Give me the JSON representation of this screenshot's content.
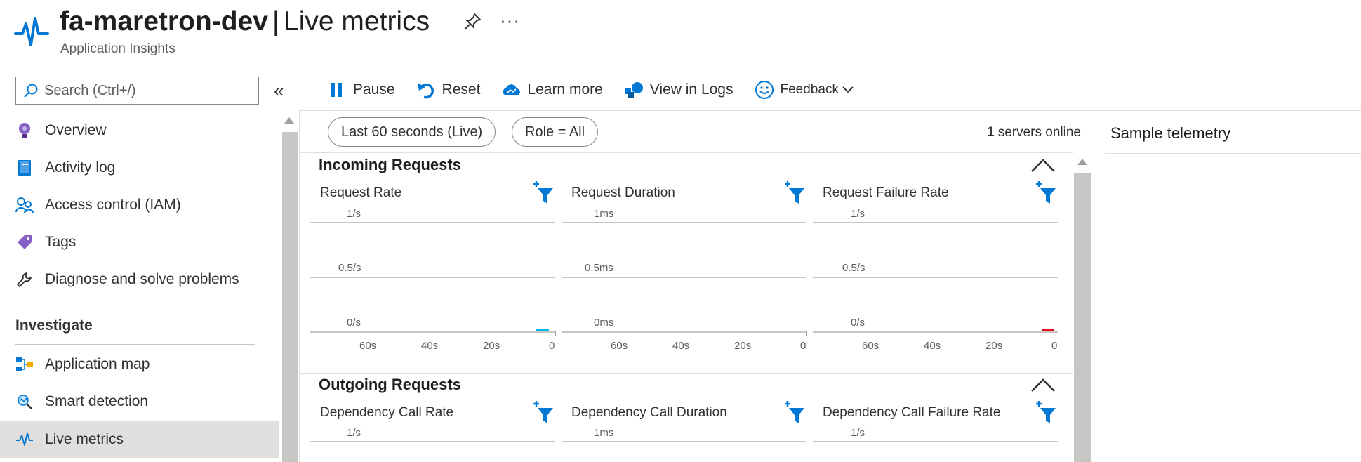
{
  "header": {
    "resource_name": "fa-maretron-dev",
    "separator": "|",
    "page_name": "Live metrics",
    "subtitle": "Application Insights",
    "more_label": "···"
  },
  "search": {
    "placeholder": "Search (Ctrl+/)",
    "collapse_label": "«"
  },
  "sidebar": {
    "items": [
      {
        "label": "Overview",
        "icon": "lightbulb-icon"
      },
      {
        "label": "Activity log",
        "icon": "book-icon"
      },
      {
        "label": "Access control (IAM)",
        "icon": "people-icon"
      },
      {
        "label": "Tags",
        "icon": "tag-icon"
      },
      {
        "label": "Diagnose and solve problems",
        "icon": "wrench-icon"
      }
    ],
    "section": "Investigate",
    "investigate_items": [
      {
        "label": "Application map",
        "icon": "app-map-icon"
      },
      {
        "label": "Smart detection",
        "icon": "smart-detection-icon"
      },
      {
        "label": "Live metrics",
        "icon": "pulse-icon",
        "active": true
      }
    ]
  },
  "toolbar": {
    "pause": "Pause",
    "reset": "Reset",
    "learn_more": "Learn more",
    "view_in_logs": "View in Logs",
    "feedback": "Feedback"
  },
  "filters": {
    "time_range": "Last 60 seconds (Live)",
    "role": "Role = All",
    "servers_count": "1",
    "servers_label": " servers online"
  },
  "sample_telemetry": {
    "title": "Sample telemetry"
  },
  "sections": {
    "incoming": {
      "title": "Incoming Requests",
      "charts": [
        {
          "title": "Request Rate",
          "y_top": "1/s",
          "y_mid": "0.5/s",
          "y_bot": "0/s",
          "spike_color": "#00b7e8"
        },
        {
          "title": "Request Duration",
          "y_top": "1ms",
          "y_mid": "0.5ms",
          "y_bot": "0ms",
          "spike_color": ""
        },
        {
          "title": "Request Failure Rate",
          "y_top": "1/s",
          "y_mid": "0.5/s",
          "y_bot": "0/s",
          "spike_color": "#e81123"
        }
      ]
    },
    "outgoing": {
      "title": "Outgoing Requests",
      "charts": [
        {
          "title": "Dependency Call Rate",
          "y_top": "1/s"
        },
        {
          "title": "Dependency Call Duration",
          "y_top": "1ms"
        },
        {
          "title": "Dependency Call Failure Rate",
          "y_top": "1/s"
        }
      ]
    }
  },
  "x_ticks": [
    "60s",
    "40s",
    "20s",
    "0"
  ],
  "colors": {
    "accent": "#0078d4",
    "icon_blue": "#005ba1",
    "live_blue": "#00b7e8",
    "failure_red": "#e81123"
  }
}
